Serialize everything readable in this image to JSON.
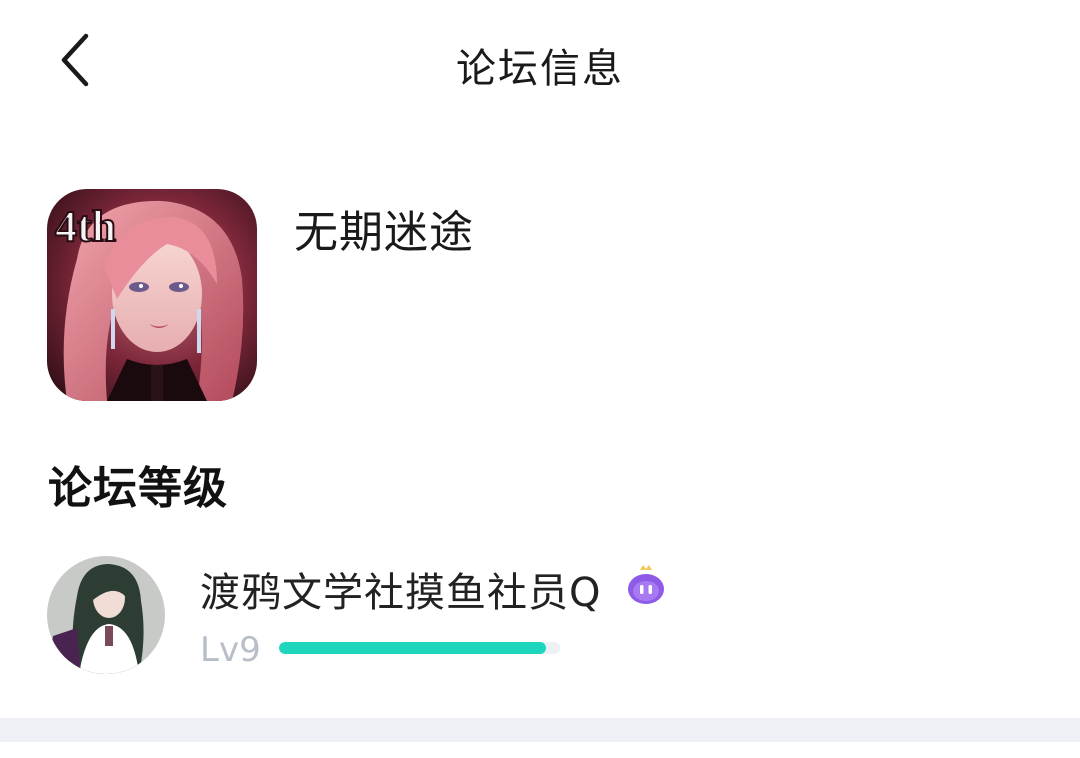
{
  "header": {
    "title": "论坛信息",
    "back_icon": "chevron-left-icon"
  },
  "forum": {
    "name": "无期迷途",
    "icon_badge_text": "4th"
  },
  "level_section": {
    "title": "论坛等级",
    "user": {
      "name": "渡鸦文学社摸鱼社员Q",
      "level": "Lv9",
      "progress": 0.95,
      "badge_icon": "purple-mascot-badge-icon"
    }
  },
  "colors": {
    "progress_fill": "#1ed6be",
    "progress_track": "#eef1f4",
    "level_text": "#b8bec8",
    "divider": "#eef0f6"
  }
}
